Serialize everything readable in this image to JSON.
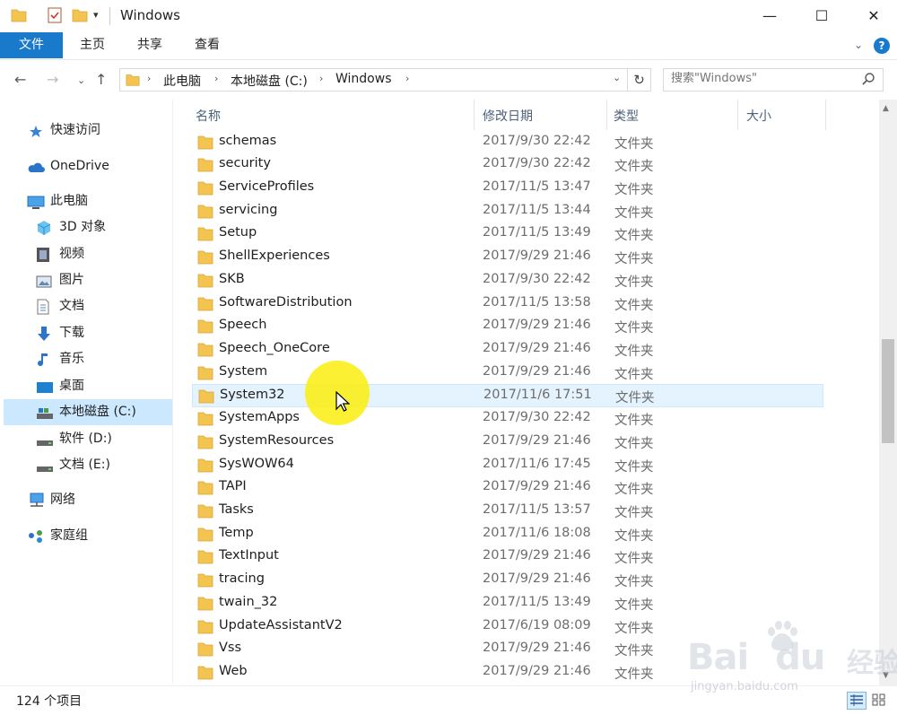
{
  "window": {
    "title": "Windows",
    "dropdown_glyph": "▾",
    "minimize": "—",
    "maximize": "☐",
    "close": "✕"
  },
  "ribbon": {
    "tabs": [
      "文件",
      "主页",
      "共享",
      "查看"
    ],
    "expand_glyph": "⌄",
    "help_glyph": "?"
  },
  "nav": {
    "back": "←",
    "forward": "→",
    "recent": "⌄",
    "up": "↑"
  },
  "address": {
    "crumbs": [
      "此电脑",
      "本地磁盘 (C:)",
      "Windows"
    ],
    "separator": "›",
    "dropdown": "⌄",
    "refresh": "↻"
  },
  "search": {
    "placeholder": "搜索\"Windows\""
  },
  "sidebar": {
    "items": [
      {
        "label": "快速访问",
        "icon": "star-icon"
      },
      {
        "label": "OneDrive",
        "icon": "cloud-icon"
      },
      {
        "label": "此电脑",
        "icon": "computer-icon"
      },
      {
        "label": "3D 对象",
        "icon": "cube-icon"
      },
      {
        "label": "视频",
        "icon": "video-icon"
      },
      {
        "label": "图片",
        "icon": "picture-icon"
      },
      {
        "label": "文档",
        "icon": "document-icon"
      },
      {
        "label": "下载",
        "icon": "download-icon"
      },
      {
        "label": "音乐",
        "icon": "music-icon"
      },
      {
        "label": "桌面",
        "icon": "desktop-icon"
      },
      {
        "label": "本地磁盘 (C:)",
        "icon": "drive-c-icon",
        "selected": true
      },
      {
        "label": "软件 (D:)",
        "icon": "drive-icon"
      },
      {
        "label": "文档 (E:)",
        "icon": "drive-icon"
      },
      {
        "label": "网络",
        "icon": "network-icon"
      },
      {
        "label": "家庭组",
        "icon": "homegroup-icon"
      }
    ]
  },
  "columns": {
    "name": "名称",
    "modified": "修改日期",
    "type": "类型",
    "size": "大小",
    "sort_glyph": "˄"
  },
  "files": [
    {
      "name": "schemas",
      "modified": "2017/9/30 22:42",
      "type": "文件夹"
    },
    {
      "name": "security",
      "modified": "2017/9/30 22:42",
      "type": "文件夹"
    },
    {
      "name": "ServiceProfiles",
      "modified": "2017/11/5 13:47",
      "type": "文件夹"
    },
    {
      "name": "servicing",
      "modified": "2017/11/5 13:44",
      "type": "文件夹"
    },
    {
      "name": "Setup",
      "modified": "2017/11/5 13:49",
      "type": "文件夹"
    },
    {
      "name": "ShellExperiences",
      "modified": "2017/9/29 21:46",
      "type": "文件夹"
    },
    {
      "name": "SKB",
      "modified": "2017/9/30 22:42",
      "type": "文件夹"
    },
    {
      "name": "SoftwareDistribution",
      "modified": "2017/11/5 13:58",
      "type": "文件夹"
    },
    {
      "name": "Speech",
      "modified": "2017/9/29 21:46",
      "type": "文件夹"
    },
    {
      "name": "Speech_OneCore",
      "modified": "2017/9/29 21:46",
      "type": "文件夹"
    },
    {
      "name": "System",
      "modified": "2017/9/29 21:46",
      "type": "文件夹"
    },
    {
      "name": "System32",
      "modified": "2017/11/6 17:51",
      "type": "文件夹",
      "hover": true
    },
    {
      "name": "SystemApps",
      "modified": "2017/9/30 22:42",
      "type": "文件夹"
    },
    {
      "name": "SystemResources",
      "modified": "2017/9/29 21:46",
      "type": "文件夹"
    },
    {
      "name": "SysWOW64",
      "modified": "2017/11/6 17:45",
      "type": "文件夹"
    },
    {
      "name": "TAPI",
      "modified": "2017/9/29 21:46",
      "type": "文件夹"
    },
    {
      "name": "Tasks",
      "modified": "2017/11/5 13:57",
      "type": "文件夹"
    },
    {
      "name": "Temp",
      "modified": "2017/11/6 18:08",
      "type": "文件夹"
    },
    {
      "name": "TextInput",
      "modified": "2017/9/29 21:46",
      "type": "文件夹"
    },
    {
      "name": "tracing",
      "modified": "2017/9/29 21:46",
      "type": "文件夹"
    },
    {
      "name": "twain_32",
      "modified": "2017/11/5 13:49",
      "type": "文件夹"
    },
    {
      "name": "UpdateAssistantV2",
      "modified": "2017/6/19 08:09",
      "type": "文件夹"
    },
    {
      "name": "Vss",
      "modified": "2017/9/29 21:46",
      "type": "文件夹"
    },
    {
      "name": "Web",
      "modified": "2017/9/29 21:46",
      "type": "文件夹"
    }
  ],
  "status": {
    "item_count": "124 个项目"
  },
  "scrollbar": {
    "position": 0.5,
    "up_glyph": "▲",
    "down_glyph": "▼"
  },
  "watermark": {
    "brand": "Bai",
    "brand_suffix": "du",
    "cn": "经验",
    "url": "jingyan.baidu.com"
  },
  "colors": {
    "accent": "#1979ca",
    "folder": "#f4c451",
    "selected": "#cce8ff",
    "hover": "#e5f3ff",
    "highlight": "#faee14"
  }
}
